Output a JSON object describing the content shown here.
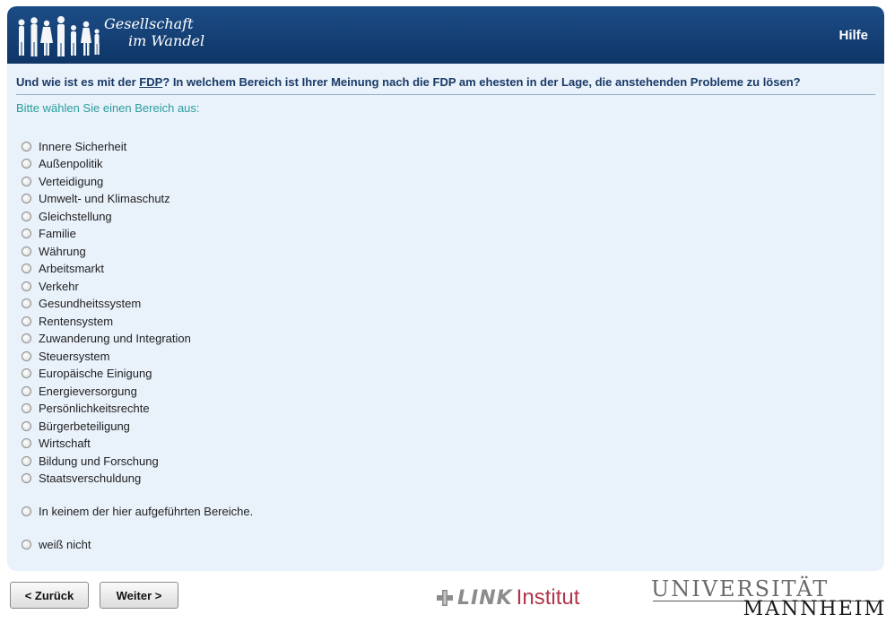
{
  "header": {
    "logo_line1": "Gesellschaft",
    "logo_line2": "im Wandel",
    "logo_icon": "people-silhouette-icon",
    "help_label": "Hilfe",
    "color": "#123c70"
  },
  "question": {
    "prefix": "Und wie ist es mit der ",
    "party": "FDP",
    "suffix": "? In welchem Bereich ist Ihrer Meinung nach die FDP am ehesten in der Lage, die anstehenden Probleme zu lösen?"
  },
  "instruction": "Bitte wählen Sie einen Bereich aus:",
  "options": [
    "Innere Sicherheit",
    "Außenpolitik",
    "Verteidigung",
    "Umwelt- und Klimaschutz",
    "Gleichstellung",
    "Familie",
    "Währung",
    "Arbeitsmarkt",
    "Verkehr",
    "Gesundheitssystem",
    "Rentensystem",
    "Zuwanderung und Integration",
    "Steuersystem",
    "Europäische Einigung",
    "Energieversorgung",
    "Persönlichkeitsrechte",
    "Bürgerbeteiligung",
    "Wirtschaft",
    "Bildung und Forschung",
    "Staatsverschuldung"
  ],
  "option_none": "In keinem der hier aufgeführten Bereiche.",
  "option_dontknow": "weiß nicht",
  "nav": {
    "back_label": "< Zurück",
    "next_label": "Weiter >"
  },
  "footer": {
    "link_bold": "LINK",
    "link_institut": "Institut",
    "uni_line1": "UNIVERSITÄT",
    "uni_line2": "MANNHEIM"
  }
}
